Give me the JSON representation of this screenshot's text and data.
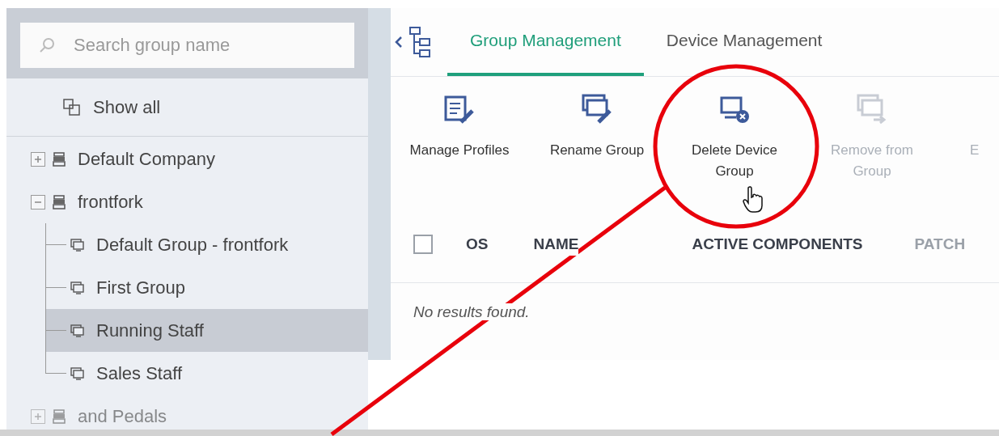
{
  "sidebar": {
    "search": {
      "placeholder": "Search group name"
    },
    "show_all": "Show all",
    "tree": [
      {
        "label": "Default Company",
        "kind": "company",
        "expanded": false,
        "selected": false
      },
      {
        "label": "frontfork",
        "kind": "company",
        "expanded": true,
        "selected": false,
        "children": [
          {
            "label": "Default Group - frontfork",
            "kind": "group",
            "selected": false
          },
          {
            "label": "First Group",
            "kind": "group",
            "selected": false
          },
          {
            "label": "Running Staff",
            "kind": "group",
            "selected": true
          },
          {
            "label": "Sales Staff",
            "kind": "group",
            "selected": false
          }
        ]
      },
      {
        "label": "and Pedals",
        "kind": "company",
        "expanded": false,
        "selected": false
      }
    ]
  },
  "tabs": [
    {
      "label": "Group Management",
      "selected": true
    },
    {
      "label": "Device Management",
      "selected": false
    }
  ],
  "toolbar": [
    {
      "label": "Manage Profiles",
      "kind": "profiles",
      "disabled": false
    },
    {
      "label": "Rename Group",
      "kind": "rename",
      "disabled": false
    },
    {
      "label": "Delete Device Group",
      "kind": "delete",
      "disabled": false
    },
    {
      "label": "Remove from Group",
      "kind": "remove",
      "disabled": true
    },
    {
      "label": "E",
      "kind": "other",
      "disabled": true
    }
  ],
  "table": {
    "select_all": {
      "checked": false
    },
    "columns": [
      {
        "label": "OS",
        "disabled": false
      },
      {
        "label": "NAME",
        "disabled": false
      },
      {
        "label": "ACTIVE COMPONENTS",
        "disabled": false
      },
      {
        "label": "PATCH",
        "disabled": true
      }
    ],
    "empty_message": "No results found."
  }
}
